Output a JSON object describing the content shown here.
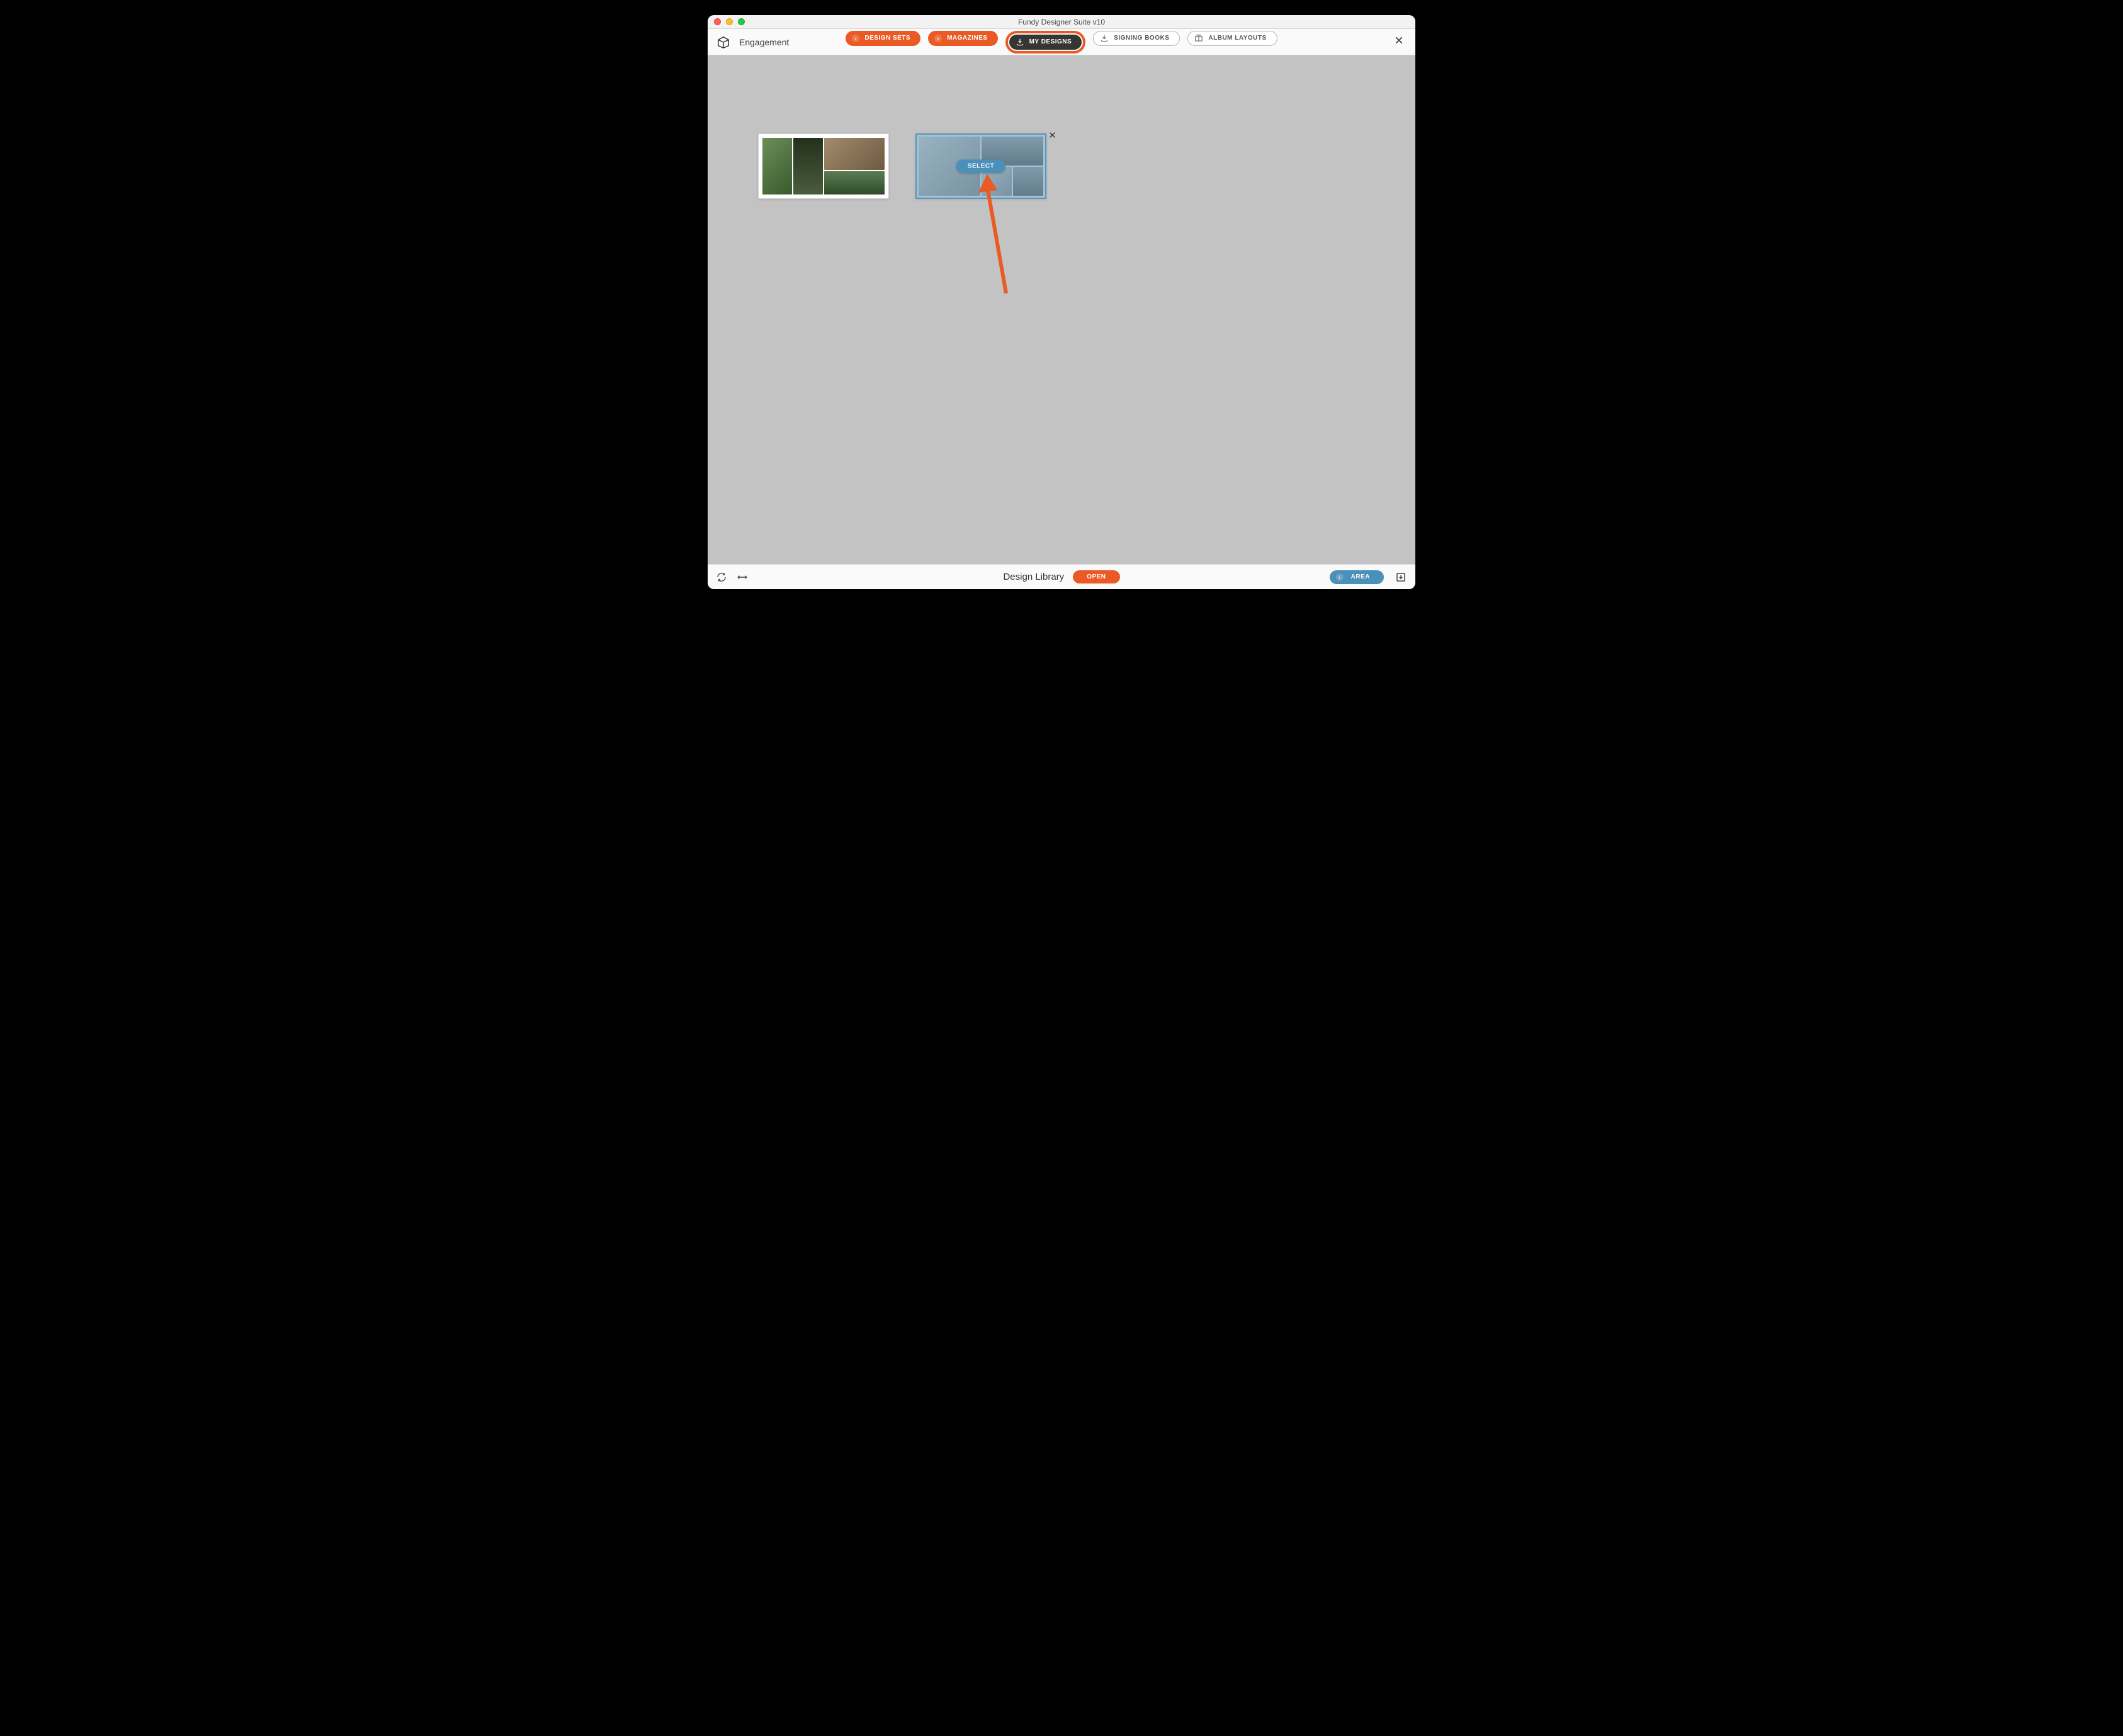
{
  "window": {
    "title": "Fundy Designer Suite v10"
  },
  "project": {
    "name": "Engagement"
  },
  "toolbar": {
    "design_sets": "DESIGN SETS",
    "magazines": "MAGAZINES",
    "my_designs": "MY DESIGNS",
    "signing_books": "SIGNING BOOKS",
    "album_layouts": "ALBUM LAYOUTS"
  },
  "designs": {
    "select_label": "SELECT"
  },
  "bottom": {
    "library_title": "Design Library",
    "open_label": "OPEN",
    "area_label": "AREA"
  },
  "colors": {
    "accent_orange": "#eb5a24",
    "accent_blue": "#4a90b8",
    "window_bg": "#c3c3c3"
  },
  "icons": {
    "brand": "brand-icon",
    "import": "import-icon",
    "album": "album-icon",
    "close": "close-icon",
    "refresh": "refresh-icon",
    "resize": "resize-icon",
    "download": "download-icon"
  }
}
